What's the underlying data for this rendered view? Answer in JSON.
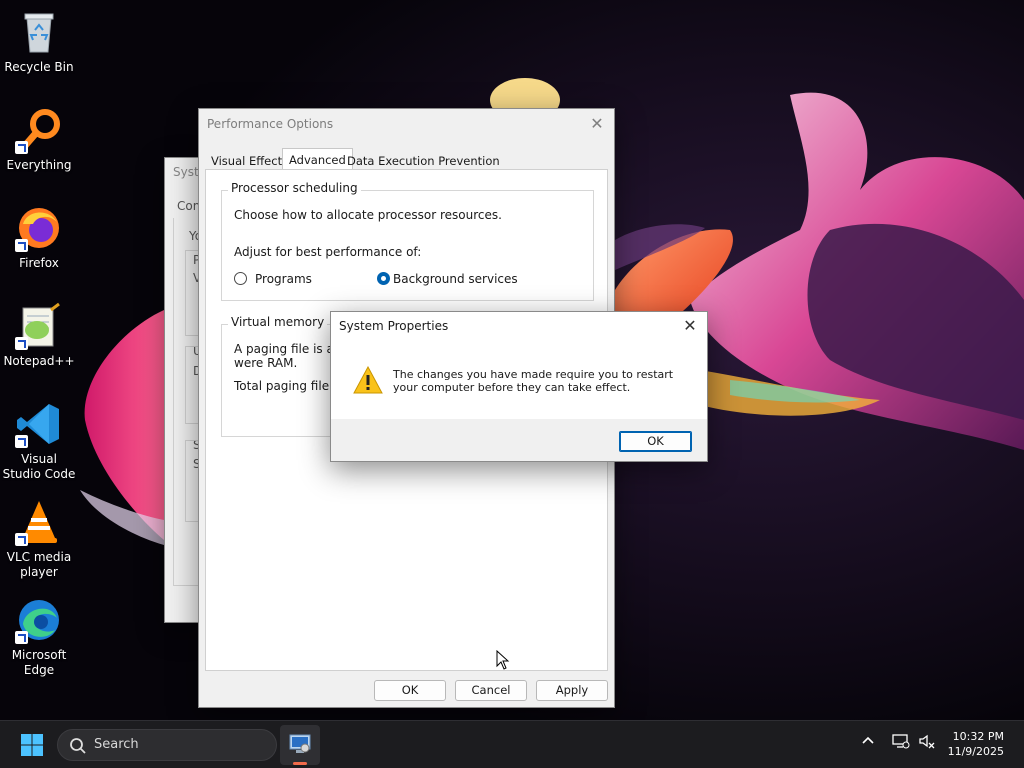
{
  "desktop": {
    "icons": [
      {
        "label": "Recycle Bin",
        "icon": "recycle-bin-icon",
        "shortcut": false
      },
      {
        "label": "Everything",
        "icon": "everything-search-icon",
        "shortcut": true
      },
      {
        "label": "Firefox",
        "icon": "firefox-icon",
        "shortcut": true
      },
      {
        "label": "Notepad++",
        "icon": "notepad-plus-plus-icon",
        "shortcut": true
      },
      {
        "label": "Visual Studio Code",
        "icon": "vscode-icon",
        "shortcut": true
      },
      {
        "label": "VLC media player",
        "icon": "vlc-icon",
        "shortcut": true
      },
      {
        "label": "Microsoft Edge",
        "icon": "edge-icon",
        "shortcut": true
      }
    ]
  },
  "system_properties_back": {
    "title_fragment": "Syste",
    "tab_fragment": "Com",
    "text_fragments": [
      "Yo",
      "P",
      "V",
      "U",
      "D",
      "S",
      "S"
    ]
  },
  "performance_options": {
    "title": "Performance Options",
    "tabs": [
      "Visual Effects",
      "Advanced",
      "Data Execution Prevention"
    ],
    "active_tab": "Advanced",
    "processor": {
      "title": "Processor scheduling",
      "description": "Choose how to allocate processor resources.",
      "adjust_label": "Adjust for best performance of:",
      "options": [
        {
          "label": "Programs",
          "selected": false
        },
        {
          "label": "Background services",
          "selected": true
        }
      ]
    },
    "virtual_memory": {
      "title": "Virtual memory",
      "line1": "A paging file is an",
      "line2": "were RAM.",
      "line3": "Total paging file siz"
    },
    "buttons": {
      "ok": "OK",
      "cancel": "Cancel",
      "apply": "Apply"
    }
  },
  "dialog": {
    "title": "System Properties",
    "message": "The changes you have made require you to restart your computer before they can take effect.",
    "ok": "OK",
    "icon": "warning-icon"
  },
  "taskbar": {
    "search_placeholder": "Search",
    "time": "10:32 PM",
    "date": "11/9/2025",
    "accent": "#f26b4b"
  }
}
